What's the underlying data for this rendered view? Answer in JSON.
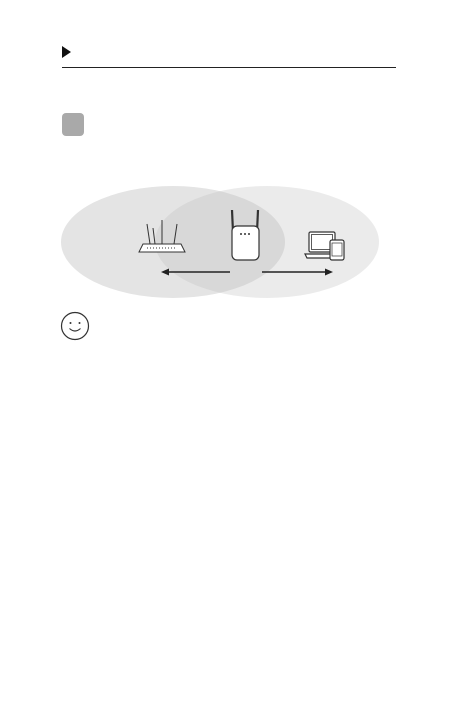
{
  "header": {
    "marker_icon": "play-triangle-icon",
    "title": ""
  },
  "step": {
    "number": "",
    "color": "#a9a9a9"
  },
  "diagram": {
    "left_device": "router-icon",
    "center_device": "range-extender-icon",
    "right_devices": [
      "laptop-icon",
      "tablet-icon"
    ],
    "coverage_color": "#e6e6e6",
    "overlap_color": "#d9d9d9"
  },
  "tip": {
    "icon": "smiley-face-icon",
    "text": ""
  }
}
